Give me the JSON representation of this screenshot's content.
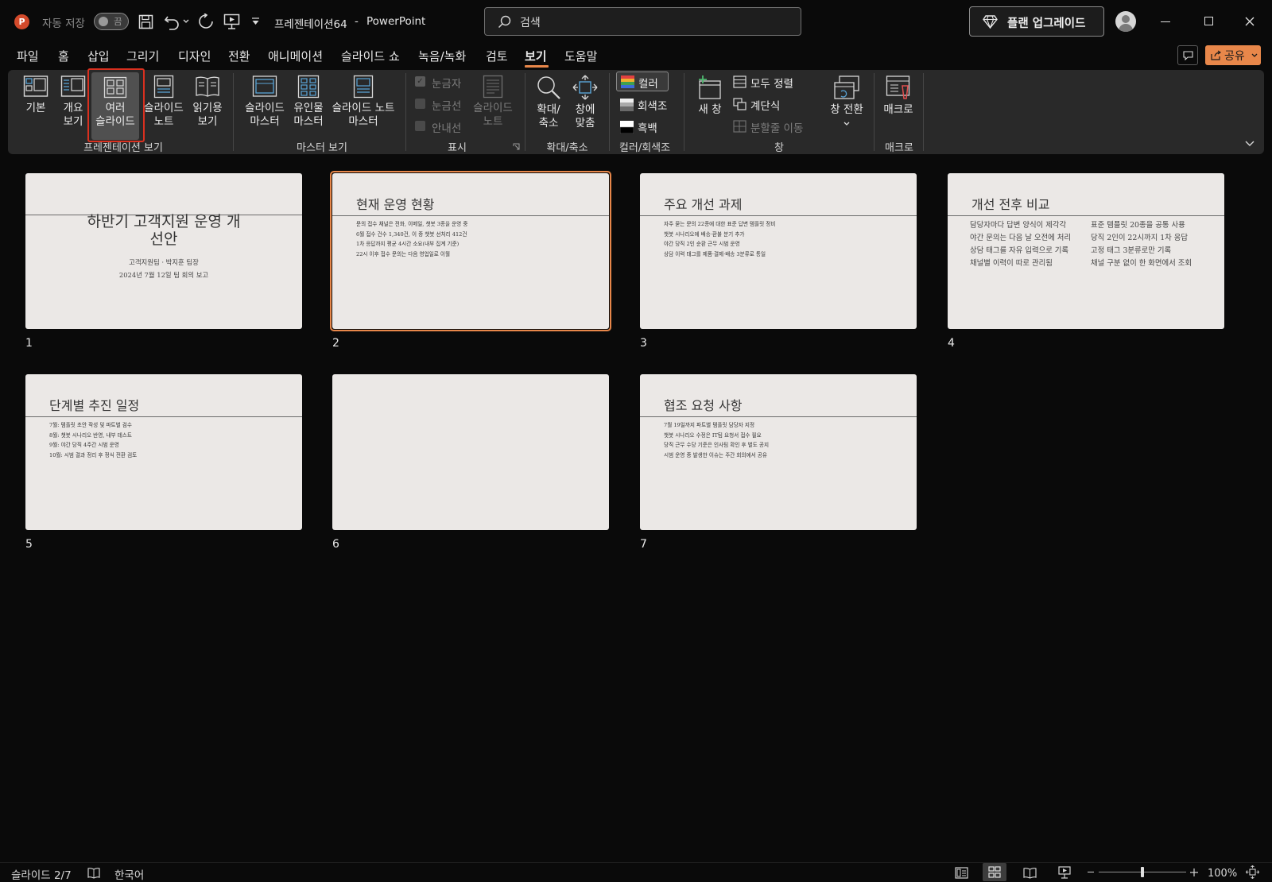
{
  "titlebar": {
    "autosave_label": "자동 저장",
    "autosave_state": "끔",
    "doc_title": "프레젠테이션64",
    "separator": "-",
    "app_name": "PowerPoint",
    "search_placeholder": "검색",
    "upgrade_label": "플랜 업그레이드"
  },
  "menu": {
    "tabs": [
      "파일",
      "홈",
      "삽입",
      "그리기",
      "디자인",
      "전환",
      "애니메이션",
      "슬라이드 쇼",
      "녹음/녹화",
      "검토",
      "보기",
      "도움말"
    ],
    "active_tab": "보기",
    "share_label": "공유"
  },
  "ribbon": {
    "pres_views": {
      "label": "프레젠테이션 보기",
      "buttons": [
        {
          "l1": "기본",
          "l2": ""
        },
        {
          "l1": "개요",
          "l2": "보기"
        },
        {
          "l1": "여러",
          "l2": "슬라이드"
        },
        {
          "l1": "슬라이드",
          "l2": "노트"
        },
        {
          "l1": "읽기용",
          "l2": "보기"
        }
      ]
    },
    "master_views": {
      "label": "마스터 보기",
      "buttons": [
        {
          "l1": "슬라이드",
          "l2": "마스터"
        },
        {
          "l1": "유인물",
          "l2": "마스터"
        },
        {
          "l1": "슬라이드 노트",
          "l2": "마스터"
        }
      ]
    },
    "show": {
      "label": "표시",
      "ruler": "눈금자",
      "gridlines": "눈금선",
      "guides": "안내선",
      "notes_l1": "슬라이드",
      "notes_l2": "노트"
    },
    "zoom": {
      "label": "확대/축소",
      "zoom_l1": "확대/",
      "zoom_l2": "축소",
      "fit_l1": "창에",
      "fit_l2": "맞춤"
    },
    "color": {
      "label": "컬러/회색조",
      "color": "컬러",
      "grayscale": "회색조",
      "bw": "흑백"
    },
    "window": {
      "label": "창",
      "new_window": "새 창",
      "arrange_all": "모두 정렬",
      "cascade": "계단식",
      "move_split": "분할줄 이동",
      "switch_l1": "창 전환"
    },
    "macros": {
      "label": "매크로",
      "button": "매크로"
    }
  },
  "slides": [
    {
      "num": "1",
      "title_l1": "하반기 고객지원 운영 개",
      "title_l2": "선안",
      "sub1": "고객지원팀 · 박지훈 팀장",
      "sub2": "2024년 7월 12일 팀 회의 보고"
    },
    {
      "num": "2",
      "title": "현재 운영 현황",
      "lines": [
        "문의 접수 채널은 전화, 이메일, 챗봇 3종을 운영 중",
        "6월 접수 건수 1,340건, 이 중 챗봇 선처리 412건",
        "1차 응답까지 평균 4시간 소요(내부 집계 기준)",
        "22시 이후 접수 문의는 다음 영업일로 이월"
      ]
    },
    {
      "num": "3",
      "title": "주요 개선 과제",
      "lines": [
        "자주 묻는 문의 22종에 대한 표준 답변 템플릿 정비",
        "챗봇 시나리오에 배송·환불 분기 추가",
        "야간 당직 2인 순환 근무 시범 운영",
        "상담 이력 태그를 제품·결제·배송 3분류로 통일"
      ]
    },
    {
      "num": "4",
      "title": "개선 전후 비교",
      "left": [
        "담당자마다 답변 양식이 제각각",
        "야간 문의는 다음 날 오전에 처리",
        "상담 태그를 자유 입력으로 기록",
        "채널별 이력이 따로 관리됨"
      ],
      "right": [
        "표준 템플릿 20종을 공통 사용",
        "당직 2인이 22시까지 1차 응답",
        "고정 태그 3분류로만 기록",
        "채널 구분 없이 한 화면에서 조회"
      ]
    },
    {
      "num": "5",
      "title": "단계별 추진 일정",
      "lines": [
        "7월: 템플릿 초안 작성 및 파트별 검수",
        "8월: 챗봇 시나리오 반영, 내부 테스트",
        "9월: 야간 당직 4주간 시범 운영",
        "10월: 시범 결과 정리 후 정식 전환 검토"
      ]
    },
    {
      "num": "6"
    },
    {
      "num": "7",
      "title": "협조 요청 사항",
      "lines": [
        "7월 19일까지 파트별 템플릿 담당자 지정",
        "챗봇 시나리오 수정은 IT팀 요청서 접수 필요",
        "당직 근무 수당 기준은 인사팀 확인 후 별도 공지",
        "시범 운영 중 발생한 이슈는 주간 회의에서 공유"
      ]
    }
  ],
  "status": {
    "slide_indicator": "슬라이드 2/7",
    "language": "한국어",
    "zoom": "100%",
    "zoom_level": 0.5
  },
  "colors": {
    "accent": "#e8874a",
    "selection": "#d9301f",
    "ribbon_bg": "#292929",
    "slide_bg": "#ebe8e6"
  }
}
